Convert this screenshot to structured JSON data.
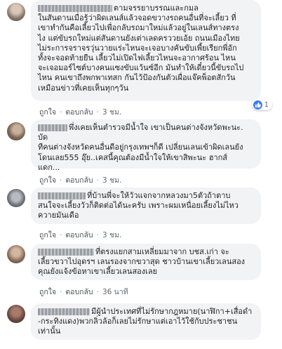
{
  "colors": {
    "link_blue": "#385898",
    "bubble": "#f2f3f5",
    "like_blue": "#3b7bf0"
  },
  "comments": [
    {
      "text": "ตามจรรยาบรรณและกมล\nในสันดานเมื่อรู้ว่าผิดเลนส์แล้วจอดขวางรถคนอื่นที่จะเลี้ยว ที่\nเขาทำกันคือเลี้ยวไปเพื่อกลับรถมาใหม่แล้วอยู่ในเลนส์ทางตรง\nไง แต่ขับรถใหม่แต่สันดานยังเต่าเลดครววยเอ้ย ถนนเมืองไทย\nไม่ระการจราจรวุ่นวายแร่ะไหนจะเจอบางคันขับเพี้ยเรียกพี่อัก\nทั้งจะจอดท้ายยืน เลี้ยวไม่เปิดไฟเลี้ยวไหนจะอากาศร้อน ไหน\nจะเจอมอร์ไซต์บางคนแซงขับแว้นซ์อีก มันทำให้เดี๋ยวนี้ขับรถไป\nไหน คนเขาถึงพกพาเทสก กันไว้ป้องกันตัวเผื่อแจ๊คพ็อตสักวัน\nเหมือนข่าวที่เคยเห็นทุกๆวัน",
      "like": "ถูกใจ",
      "reply": "ตอบกลับ",
      "time": "3 ชม.",
      "reaction_count": "1"
    },
    {
      "text": "พึ่งเคยเห็นตำรวจมีน้ำใจ เขาเป็นคนต่างจังหวัดพะนะ. บัด\nทีคนต่างจังหวัดคนอื่นดีอยู่กรุงเทพฯก็ดี เปลี่ยนเลนเข้าผิดเลนยัง\nโดนเลย555 อุ๊ย..เคสนี้คุณต้องมีน้ำใจให้เขาสิพะนะ ฮากส์\nแดก...",
      "like": "ถูกใจ",
      "reply": "ตอบกลับ",
      "time": "3 ชม."
    },
    {
      "text": "ที่บ้านพี่จะให้วัวแจกจากหลวงมา5ตัวถ้าตาบ\nสนใจจะเลี้ยงวัวก็ติดต่อได้นะครับ เพราะผมเหนื่อยเลี้ยงไม่ไหว\nควายมันเดือ",
      "like": "ถูกใจ",
      "reply": "ตอบกลับ",
      "time": "3 ชม."
    },
    {
      "text": "ที่ตรงแยกสามเหลี่ยมมาจาก บชส.เก่า จะ\nเลี้ยวขวาไปอุดรฯ เลนรองจากขวาสุด ชาวบ้านเขาเลี้ยวเลนสอง\nคุณยังแจ้งข้อหาเขาเลี้ยวเลนสองเลย",
      "like": "ถูกใจ",
      "reply": "ตอบกลับ",
      "time": "36 นาที"
    },
    {
      "text": "มีผู้นำประเทศที่ไม่รักษากฎหมาย(นาฬิกา+เสื่อดำ\n-กระทิงแดง)พวกลิ่วล้อก็เลยไม่รักษาแต่เอาไว้ใช้กับประชาชน\nเท่านั้น",
      "like": "",
      "reply": "",
      "time": ""
    }
  ]
}
